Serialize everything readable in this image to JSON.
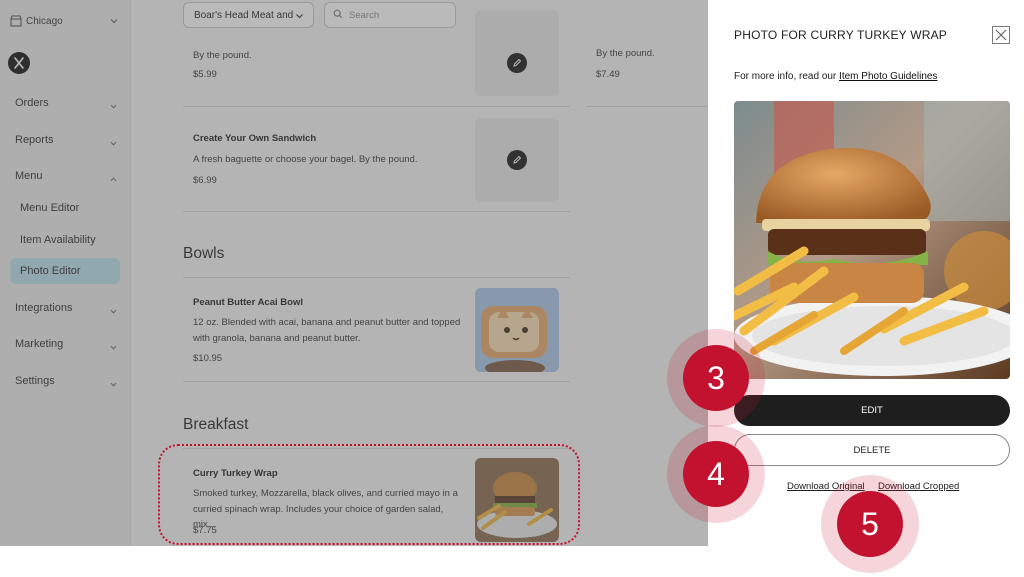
{
  "sidebar": {
    "location": "Chicago",
    "items": [
      {
        "label": "Orders"
      },
      {
        "label": "Reports"
      },
      {
        "label": "Menu"
      },
      {
        "label": "Integrations"
      },
      {
        "label": "Marketing"
      },
      {
        "label": "Settings"
      }
    ],
    "menu_subitems": [
      {
        "label": "Menu Editor"
      },
      {
        "label": "Item Availability"
      },
      {
        "label": "Photo Editor",
        "active": true
      }
    ]
  },
  "main": {
    "filter_value": "Boar's Head Meat and",
    "search_placeholder": "Search",
    "top_partial": {
      "desc": "By the pound.",
      "price": "$5.99"
    },
    "right_partial": {
      "desc": "By the pound.",
      "price": "$7.49"
    },
    "sections": [
      {
        "title": "",
        "items": [
          {
            "name": "Create Your Own Sandwich",
            "desc": "A fresh baguette or choose your bagel. By the pound.",
            "price": "$6.99"
          }
        ]
      },
      {
        "title": "Bowls",
        "items": [
          {
            "name": "Peanut Butter Acai Bowl",
            "desc": "12 oz. Blended with acai, banana and peanut butter and topped with granola, banana and peanut butter.",
            "price": "$10.95"
          }
        ]
      },
      {
        "title": "Breakfast",
        "items": [
          {
            "name": "Curry Turkey Wrap",
            "desc": "Smoked turkey, Mozzarella, black olives, and curried mayo in a curried spinach wrap. Includes your choice of garden salad, mix...",
            "price": "$7.75"
          }
        ]
      }
    ]
  },
  "drawer": {
    "title": "PHOTO FOR CURRY TURKEY WRAP",
    "info_prefix": "For more info, read our",
    "info_link": "Item Photo Guidelines",
    "edit_label": "EDIT",
    "delete_label": "DELETE",
    "download_original": "Download Original",
    "download_cropped": "Download Cropped"
  },
  "callouts": [
    "3",
    "4",
    "5"
  ],
  "colors": {
    "accent_red": "#c3122f",
    "active_nav_bg": "#b9e0ec",
    "edit_button_bg": "#1e1e1e"
  }
}
